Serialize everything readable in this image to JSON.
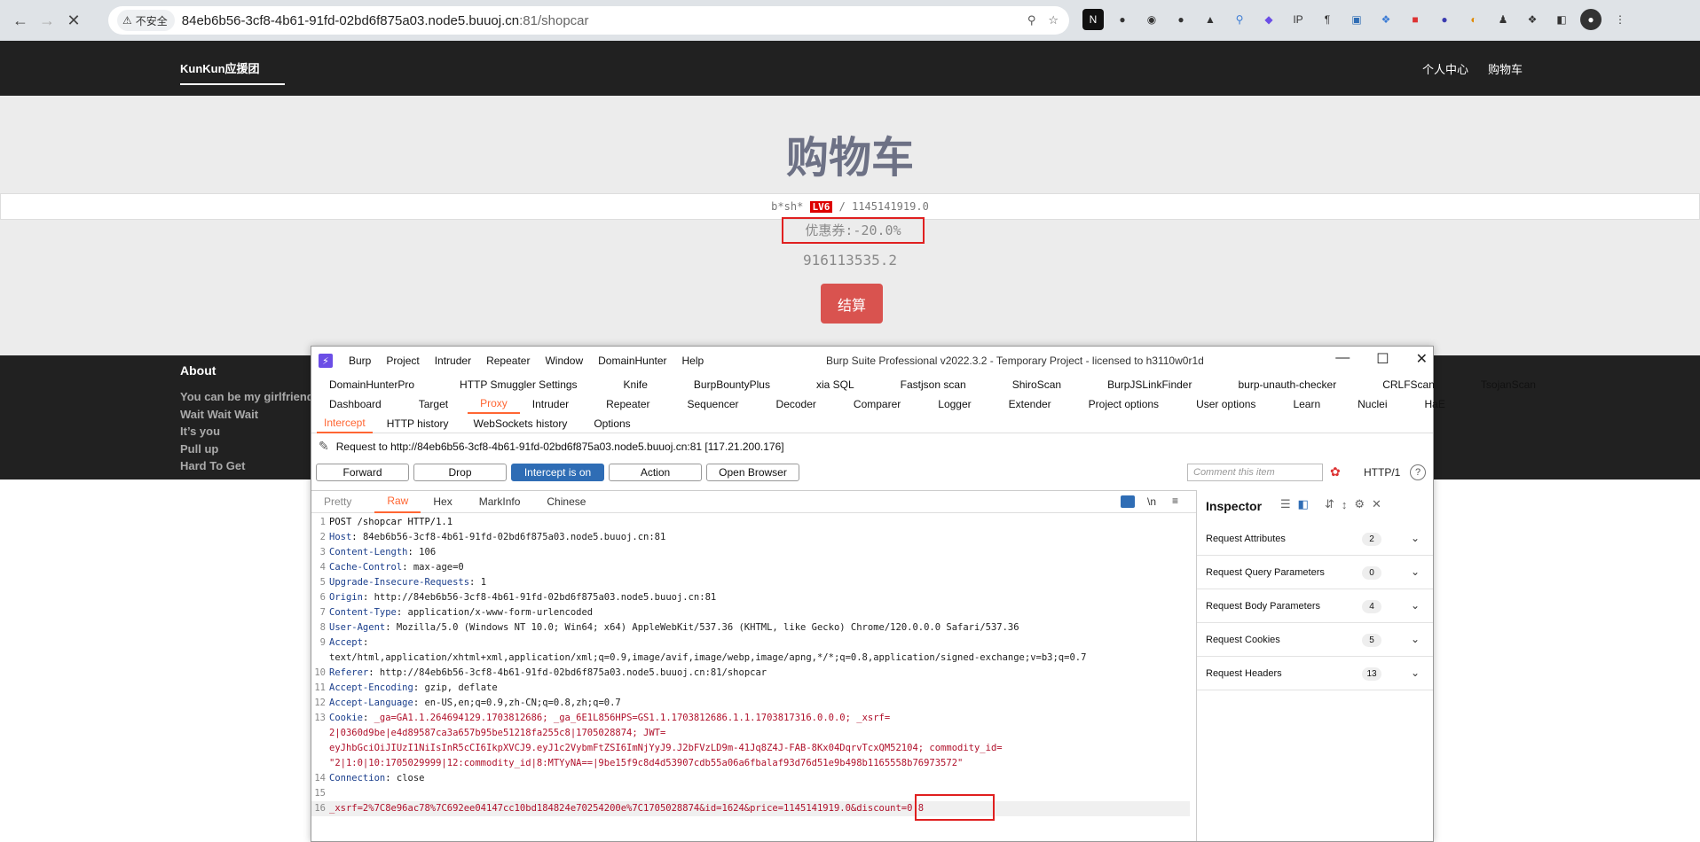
{
  "browser": {
    "security_label": "不安全",
    "url_host": "84eb6b56-3cf8-4b61-91fd-02bd6f875a03.node5.buuoj.cn",
    "url_rest": ":81/shopcar"
  },
  "site": {
    "brand": "KunKun应援团",
    "nav": [
      "个人中心",
      "购物车"
    ],
    "page_title": "购物车",
    "user": "b*sh*",
    "level": "LV6",
    "balance_sep": "/",
    "balance": "1145141919.0",
    "coupon": "优惠券:-20.0%",
    "total": "916113535.2",
    "pay_button": "结算",
    "about_title": "About",
    "about_lines": [
      "You can be my girlfriend",
      "Wait Wait Wait",
      "It’s you",
      "Pull up",
      "Hard To Get"
    ]
  },
  "burp": {
    "menu": [
      "Burp",
      "Project",
      "Intruder",
      "Repeater",
      "Window",
      "DomainHunter",
      "Help"
    ],
    "caption": "Burp Suite Professional v2022.3.2 - Temporary Project - licensed to h3110w0r1d",
    "ext_tabs": [
      "DomainHunterPro",
      "HTTP Smuggler Settings",
      "Knife",
      "BurpBountyPlus",
      "xia SQL",
      "Fastjson scan",
      "ShiroScan",
      "BurpJSLinkFinder",
      "burp-unauth-checker",
      "CRLFScan",
      "TsojanScan"
    ],
    "main_tabs": [
      "Dashboard",
      "Target",
      "Proxy",
      "Intruder",
      "Repeater",
      "Sequencer",
      "Decoder",
      "Comparer",
      "Logger",
      "Extender",
      "Project options",
      "User options",
      "Learn",
      "Nuclei",
      "HaE"
    ],
    "proxy_tabs": [
      "Intercept",
      "HTTP history",
      "WebSockets history",
      "Options"
    ],
    "request_to": "Request to http://84eb6b56-3cf8-4b61-91fd-02bd6f875a03.node5.buuoj.cn:81  [117.21.200.176]",
    "buttons": {
      "forward": "Forward",
      "drop": "Drop",
      "intercept": "Intercept is on",
      "action": "Action",
      "open_browser": "Open Browser"
    },
    "comment_placeholder": "Comment this item",
    "protocol": "HTTP/1",
    "editor_tabs": [
      "Pretty",
      "Raw",
      "Hex",
      "MarkInfo",
      "Chinese"
    ],
    "newline_toggle": "\\n",
    "request_line": "POST /shopcar HTTP/1.1",
    "headers": [
      {
        "k": "Host",
        "v": "84eb6b56-3cf8-4b61-91fd-02bd6f875a03.node5.buuoj.cn:81"
      },
      {
        "k": "Content-Length",
        "v": "106"
      },
      {
        "k": "Cache-Control",
        "v": "max-age=0"
      },
      {
        "k": "Upgrade-Insecure-Requests",
        "v": "1"
      },
      {
        "k": "Origin",
        "v": "http://84eb6b56-3cf8-4b61-91fd-02bd6f875a03.node5.buuoj.cn:81"
      },
      {
        "k": "Content-Type",
        "v": "application/x-www-form-urlencoded"
      },
      {
        "k": "User-Agent",
        "v": "Mozilla/5.0 (Windows NT 10.0; Win64; x64) AppleWebKit/537.36 (KHTML, like Gecko) Chrome/120.0.0.0 Safari/537.36"
      },
      {
        "k": "Accept",
        "v": ""
      }
    ],
    "accept_value": "text/html,application/xhtml+xml,application/xml;q=0.9,image/avif,image/webp,image/apng,*/*;q=0.8,application/signed-exchange;v=b3;q=0.7",
    "headers2": [
      {
        "k": "Referer",
        "v": "http://84eb6b56-3cf8-4b61-91fd-02bd6f875a03.node5.buuoj.cn:81/shopcar"
      },
      {
        "k": "Accept-Encoding",
        "v": "gzip, deflate"
      },
      {
        "k": "Accept-Language",
        "v": "en-US,en;q=0.9,zh-CN;q=0.8,zh;q=0.7"
      }
    ],
    "cookie_key": "Cookie",
    "cookie_line1": "_ga=GA1.1.264694129.1703812686; _ga_6E1L856HPS=GS1.1.1703812686.1.1.1703817316.0.0.0; _xsrf=",
    "cookie_line2": "2|0360d9be|e4d89587ca3a657b95be51218fa255c8|1705028874; JWT=",
    "cookie_line3": "eyJhbGciOiJIUzI1NiIsInR5cCI6IkpXVCJ9.eyJ1c2VybmFtZSI6ImNjYyJ9.J2bFVzLD9m-41Jq8Z4J-FAB-8Kx04DqrvTcxQM52104; commodity_id=",
    "cookie_line4": "\"2|1:0|10:1705029999|12:commodity_id|8:MTYyNA==|9be15f9c8d4d53907cdb55a06a6fbalaf93d76d51e9b498b1165558b76973572\"",
    "connection": {
      "k": "Connection",
      "v": "close"
    },
    "body": "_xsrf=2%7C8e96ac78%7C692ee04147cc10bd184824e70254200e%7C1705028874&id=1624&price=1145141919.0&discount=0.8",
    "inspector_title": "Inspector",
    "inspector_rows": [
      {
        "label": "Request Attributes",
        "count": "2"
      },
      {
        "label": "Request Query Parameters",
        "count": "0"
      },
      {
        "label": "Request Body Parameters",
        "count": "4"
      },
      {
        "label": "Request Cookies",
        "count": "5"
      },
      {
        "label": "Request Headers",
        "count": "13"
      }
    ]
  }
}
